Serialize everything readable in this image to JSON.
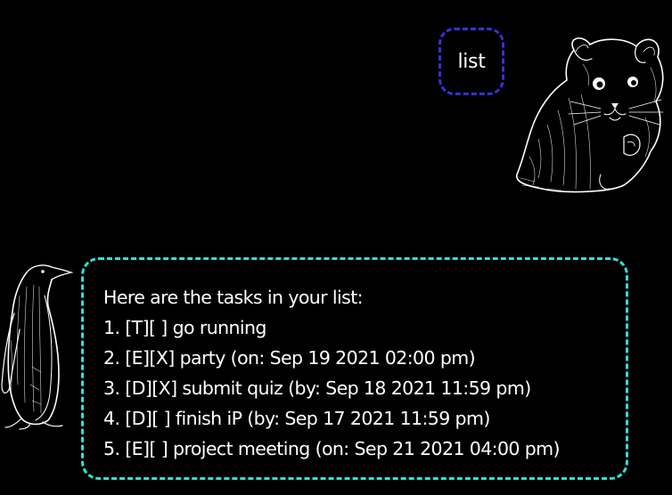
{
  "conversation": {
    "user_message": {
      "text": "list",
      "border_color": "#3b2fd6",
      "avatar_icon": "hamster-icon"
    },
    "bot_message": {
      "border_color": "#2fe0d8",
      "avatar_icon": "penguin-icon",
      "lines": [
        "Here are the tasks in your list:",
        "1. [T][ ] go running",
        "2. [E][X] party (on: Sep 19 2021 02:00 pm)",
        "3. [D][X] submit quiz (by: Sep 18 2021 11:59 pm)",
        "4. [D][ ] finish iP (by: Sep 17 2021 11:59 pm)",
        "5. [E][ ] project meeting (on: Sep 21 2021 04:00 pm)"
      ]
    }
  }
}
